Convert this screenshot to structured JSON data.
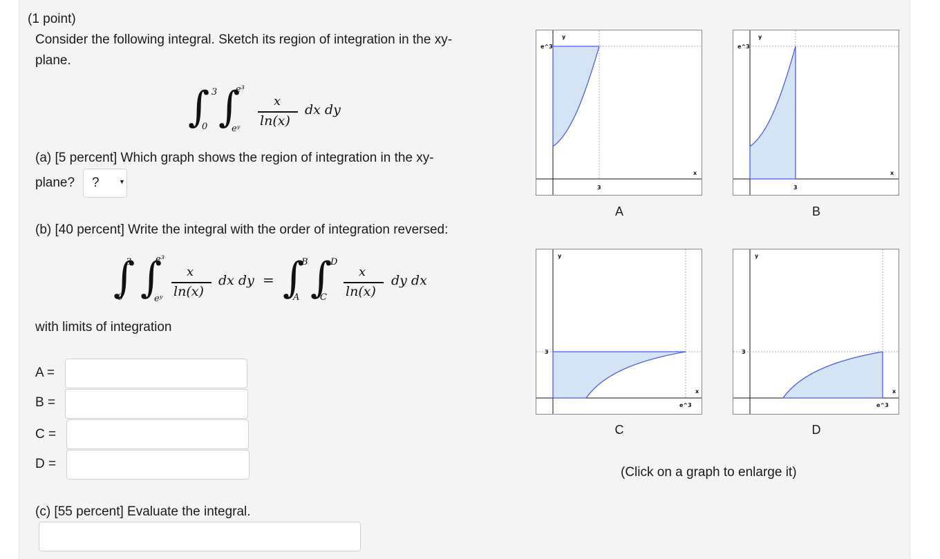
{
  "header": {
    "points": "(1 point)"
  },
  "prompt": {
    "line1": "Consider the following integral. Sketch its region of integration in the xy-",
    "line2": "plane."
  },
  "integral": {
    "outer_upper": "3",
    "outer_lower": "0",
    "inner_upper": "e³",
    "inner_lower": "eʸ",
    "numerator": "x",
    "denominator": "ln(x)",
    "differentials": "dx dy"
  },
  "part_a": {
    "line1": "(a) [5 percent] Which graph shows the region of integration in the xy-",
    "line2": "plane?",
    "select_value": "?",
    "select_arrow": "▼"
  },
  "part_b": {
    "title": "(b) [40 percent] Write the integral with the order of integration reversed:",
    "equals": "=",
    "reversed": {
      "outer_upper": "B",
      "outer_lower": "A",
      "inner_upper": "D",
      "inner_lower": "C",
      "differentials": "dy dx"
    },
    "limits_label": "with limits of integration",
    "fields": [
      {
        "label": "A =",
        "value": ""
      },
      {
        "label": "B =",
        "value": ""
      },
      {
        "label": "C =",
        "value": ""
      },
      {
        "label": "D =",
        "value": ""
      }
    ]
  },
  "part_c": {
    "title": "(c) [55 percent] Evaluate the integral.",
    "value": ""
  },
  "graphs": {
    "accent_fill": "#d5e4f5",
    "accent_stroke": "#4a5ee8",
    "items": [
      {
        "caption": "A",
        "ylabel": "y",
        "xlabel": "x",
        "ytick": "e^3",
        "xtick": "3"
      },
      {
        "caption": "B",
        "ylabel": "y",
        "xlabel": "x",
        "ytick": "e^3",
        "xtick": "3"
      },
      {
        "caption": "C",
        "ylabel": "y",
        "xlabel": "x",
        "ytick": "3",
        "xtick": "e^3"
      },
      {
        "caption": "D",
        "ylabel": "y",
        "xlabel": "x",
        "ytick": "3",
        "xtick": "e^3"
      }
    ],
    "hint": "(Click on a graph to enlarge it)"
  }
}
